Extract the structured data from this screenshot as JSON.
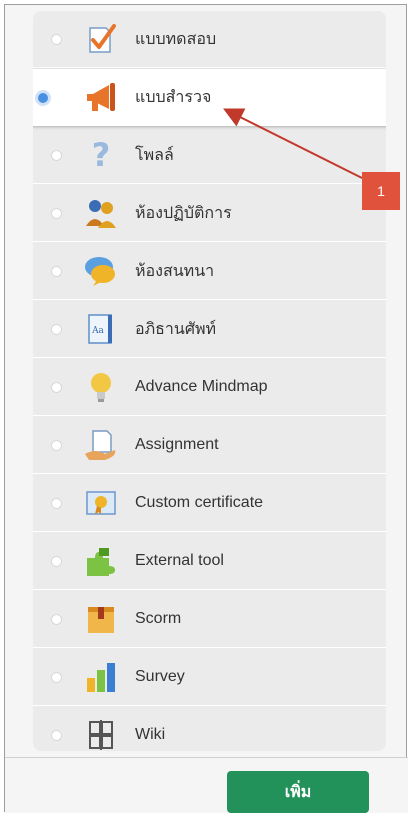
{
  "activities": [
    {
      "label": "แบบทดสอบ",
      "icon": "quiz-checkmark-icon",
      "selected": false
    },
    {
      "label": "แบบสำรวจ",
      "icon": "megaphone-icon",
      "selected": true
    },
    {
      "label": "โพลล์",
      "icon": "question-mark-icon",
      "selected": false
    },
    {
      "label": "ห้องปฏิบัติการ",
      "icon": "workshop-people-icon",
      "selected": false
    },
    {
      "label": "ห้องสนทนา",
      "icon": "chat-bubbles-icon",
      "selected": false
    },
    {
      "label": "อภิธานศัพท์",
      "icon": "glossary-book-icon",
      "selected": false
    },
    {
      "label": "Advance Mindmap",
      "icon": "lightbulb-icon",
      "selected": false
    },
    {
      "label": "Assignment",
      "icon": "assignment-hand-icon",
      "selected": false
    },
    {
      "label": "Custom certificate",
      "icon": "certificate-icon",
      "selected": false
    },
    {
      "label": "External tool",
      "icon": "puzzle-icon",
      "selected": false
    },
    {
      "label": "Scorm",
      "icon": "scorm-package-icon",
      "selected": false
    },
    {
      "label": "Survey",
      "icon": "bar-chart-icon",
      "selected": false
    },
    {
      "label": "Wiki",
      "icon": "wiki-icon",
      "selected": false
    }
  ],
  "footer": {
    "add_label": "เพิ่ม"
  },
  "callout": {
    "number": "1"
  },
  "colors": {
    "accent_green": "#22915a",
    "radio_blue": "#4a90e2",
    "callout_red": "#e0523c",
    "arrow_red": "#c0392b"
  }
}
